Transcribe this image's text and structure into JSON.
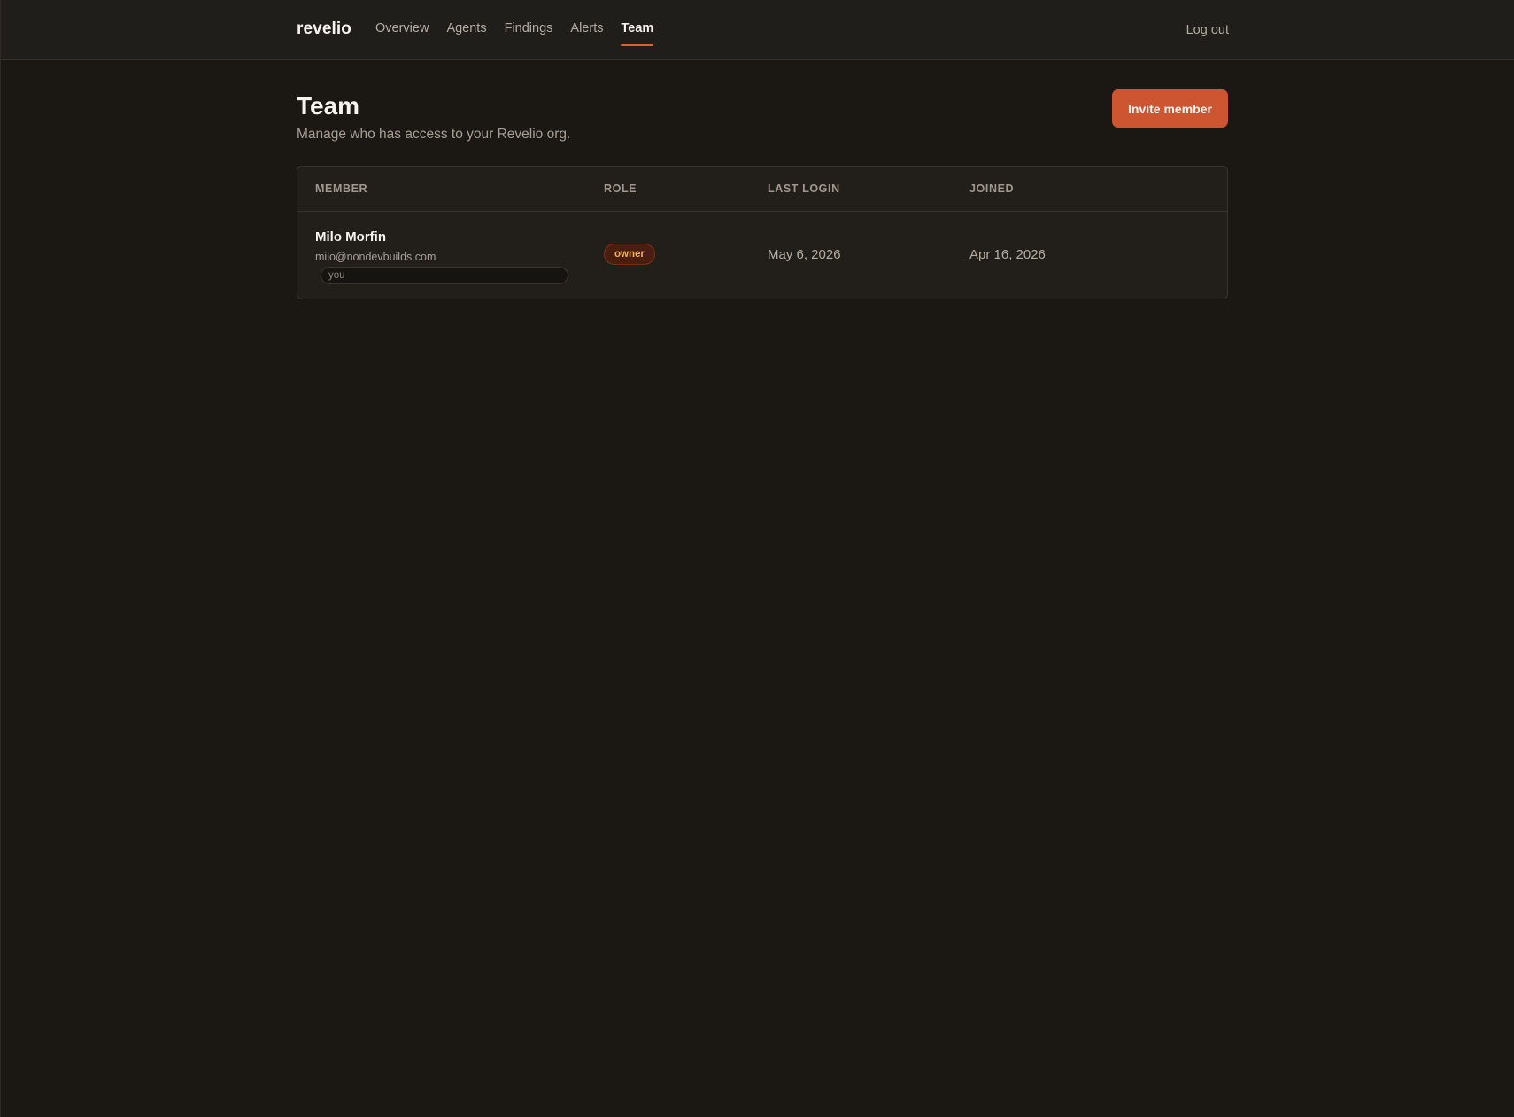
{
  "header": {
    "brand": "revelio",
    "nav": [
      {
        "label": "Overview",
        "active": false
      },
      {
        "label": "Agents",
        "active": false
      },
      {
        "label": "Findings",
        "active": false
      },
      {
        "label": "Alerts",
        "active": false
      },
      {
        "label": "Team",
        "active": true
      }
    ],
    "logout_label": "Log out"
  },
  "page": {
    "title": "Team",
    "subtitle": "Manage who has access to your Revelio org.",
    "invite_label": "Invite member"
  },
  "table": {
    "columns": [
      "MEMBER",
      "ROLE",
      "LAST LOGIN",
      "JOINED"
    ],
    "rows": [
      {
        "name": "Milo Morfin",
        "email": "milo@nondevbuilds.com",
        "tag": "you",
        "role": "owner",
        "last_login": "May 6, 2026",
        "joined": "Apr 16, 2026"
      }
    ]
  },
  "colors": {
    "accent": "#cd5530",
    "background": "#1b1814",
    "surface": "#221f1b",
    "role_owner_text": "#f2b25a"
  }
}
